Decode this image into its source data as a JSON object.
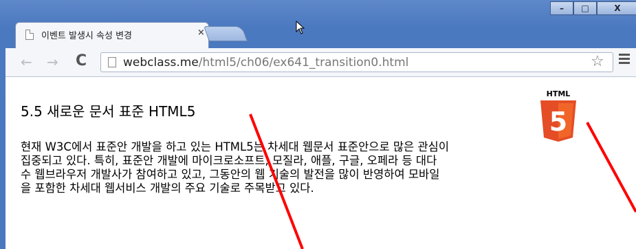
{
  "window": {
    "controls": [
      "–",
      "□",
      "X"
    ]
  },
  "tab": {
    "title": "이벤트 발생시 속성 변경",
    "close_label": "×"
  },
  "toolbar": {
    "back_icon": "←",
    "forward_icon": "→",
    "reload_icon": "C",
    "url_host": "webclass.me",
    "url_path": "/html5/ch06/ex641_transition0.html",
    "star_icon": "☆"
  },
  "page": {
    "heading": "5.5 새로운 문서 표준 HTML5",
    "paragraph_lines": [
      "현재 W3C에서 표준안 개발을 하고 있는 HTML5는 차세대 웹문서 표준안으로 많은 관심이",
      "집중되고 있다. 특히, 표준안 개발에 마이크로소프트, 모질라, 애플, 구글, 오페라 등 대다",
      "수 웹브라우저 개발사가 참여하고 있고, 그동안의 웹 기술의 발전을 많이 반영하여 모바일",
      "을 포함한 차세대 웹서비스 개발의 주요 기술로 주목받고 있다."
    ],
    "logo_text": "HTML",
    "logo_number": "5"
  },
  "colors": {
    "frame": "#4a78bf",
    "logo_orange": "#e44d26",
    "logo_orange_light": "#f16529",
    "annotation_red": "#ff0000"
  }
}
